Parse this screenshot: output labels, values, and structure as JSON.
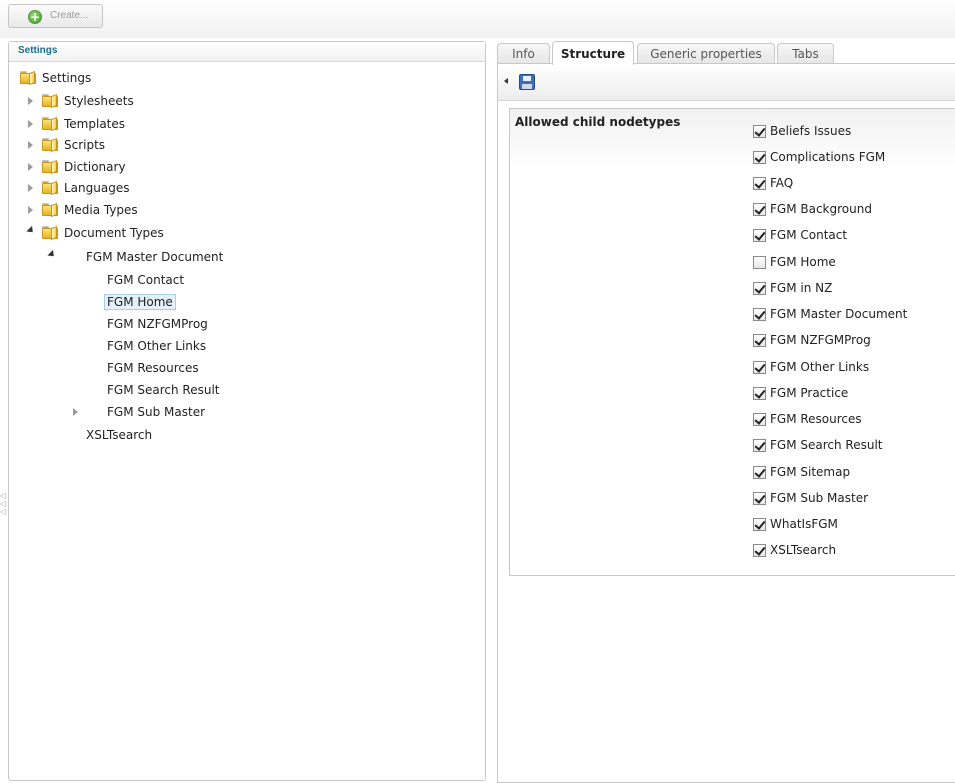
{
  "toolbar": {
    "create_label": "Create..."
  },
  "tree": {
    "header": "Settings",
    "nodes": [
      {
        "label": "Settings"
      },
      {
        "label": "Stylesheets"
      },
      {
        "label": "Templates"
      },
      {
        "label": "Scripts"
      },
      {
        "label": "Dictionary"
      },
      {
        "label": "Languages"
      },
      {
        "label": "Media Types"
      },
      {
        "label": "Document Types"
      },
      {
        "label": "FGM Master Document"
      },
      {
        "label": "FGM Contact"
      },
      {
        "label": "FGM Home"
      },
      {
        "label": "FGM NZFGMProg"
      },
      {
        "label": "FGM Other Links"
      },
      {
        "label": "FGM Resources"
      },
      {
        "label": "FGM Search Result"
      },
      {
        "label": "FGM Sub Master"
      },
      {
        "label": "XSLTsearch"
      }
    ],
    "selected": "FGM Home"
  },
  "tabs": [
    {
      "label": "Info"
    },
    {
      "label": "Structure"
    },
    {
      "label": "Generic properties"
    },
    {
      "label": "Tabs"
    }
  ],
  "active_tab": "Structure",
  "structure": {
    "title": "Allowed child nodetypes",
    "options": [
      {
        "label": "Beliefs Issues",
        "checked": true
      },
      {
        "label": "Complications FGM",
        "checked": true
      },
      {
        "label": "FAQ",
        "checked": true
      },
      {
        "label": "FGM Background",
        "checked": true
      },
      {
        "label": "FGM Contact",
        "checked": true
      },
      {
        "label": "FGM Home",
        "checked": false
      },
      {
        "label": "FGM in NZ",
        "checked": true
      },
      {
        "label": "FGM Master Document",
        "checked": true
      },
      {
        "label": "FGM NZFGMProg",
        "checked": true
      },
      {
        "label": "FGM Other Links",
        "checked": true
      },
      {
        "label": "FGM Practice",
        "checked": true
      },
      {
        "label": "FGM Resources",
        "checked": true
      },
      {
        "label": "FGM Search Result",
        "checked": true
      },
      {
        "label": "FGM Sitemap",
        "checked": true
      },
      {
        "label": "FGM Sub Master",
        "checked": true
      },
      {
        "label": "WhatIsFGM",
        "checked": true
      },
      {
        "label": "XSLTsearch",
        "checked": true
      }
    ]
  },
  "icons": {
    "create": "plus-circle-icon",
    "folder": "folder-icon",
    "save": "floppy-disk-icon"
  },
  "colors": {
    "header_text": "#1a6e8c",
    "selection_bg": "#e4f0fb",
    "create_icon": "#3f9b2a",
    "save_icon": "#3b6fb6"
  }
}
